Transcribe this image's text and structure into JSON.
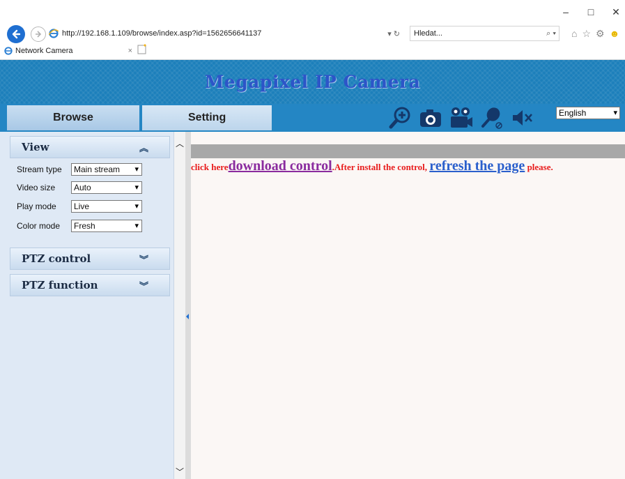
{
  "browser": {
    "url": "http://192.168.1.109/browse/index.asp?id=1562656641137",
    "search_placeholder": "Hledat...",
    "tab_title": "Network Camera",
    "tab_close": "×",
    "window_minimize": "–",
    "window_maximize": "□",
    "window_close": "✕",
    "refresh_glyph": "▾ ↻",
    "search_glyph": "⌕ ▾"
  },
  "banner": {
    "title": "Megapixel IP Camera"
  },
  "toolbar": {
    "browse_label": "Browse",
    "setting_label": "Setting",
    "icons": [
      "zoom-in-icon",
      "snapshot-camera-icon",
      "record-video-icon",
      "microphone-icon",
      "speaker-mute-icon"
    ],
    "language_value": "English",
    "accent_color": "#2486c4"
  },
  "view_panel": {
    "title": "View",
    "rows": [
      {
        "label": "Stream type",
        "value": "Main stream"
      },
      {
        "label": "Video size",
        "value": "Auto"
      },
      {
        "label": "Play mode",
        "value": "Live"
      },
      {
        "label": "Color mode",
        "value": "Fresh"
      }
    ]
  },
  "ptz_control": {
    "title": "PTZ control"
  },
  "ptz_function": {
    "title": "PTZ function"
  },
  "plugin": {
    "prefix": "click here",
    "download_link": "download control",
    "middle": ".After install the control, ",
    "refresh_link": "refresh the page",
    "suffix": " please."
  }
}
